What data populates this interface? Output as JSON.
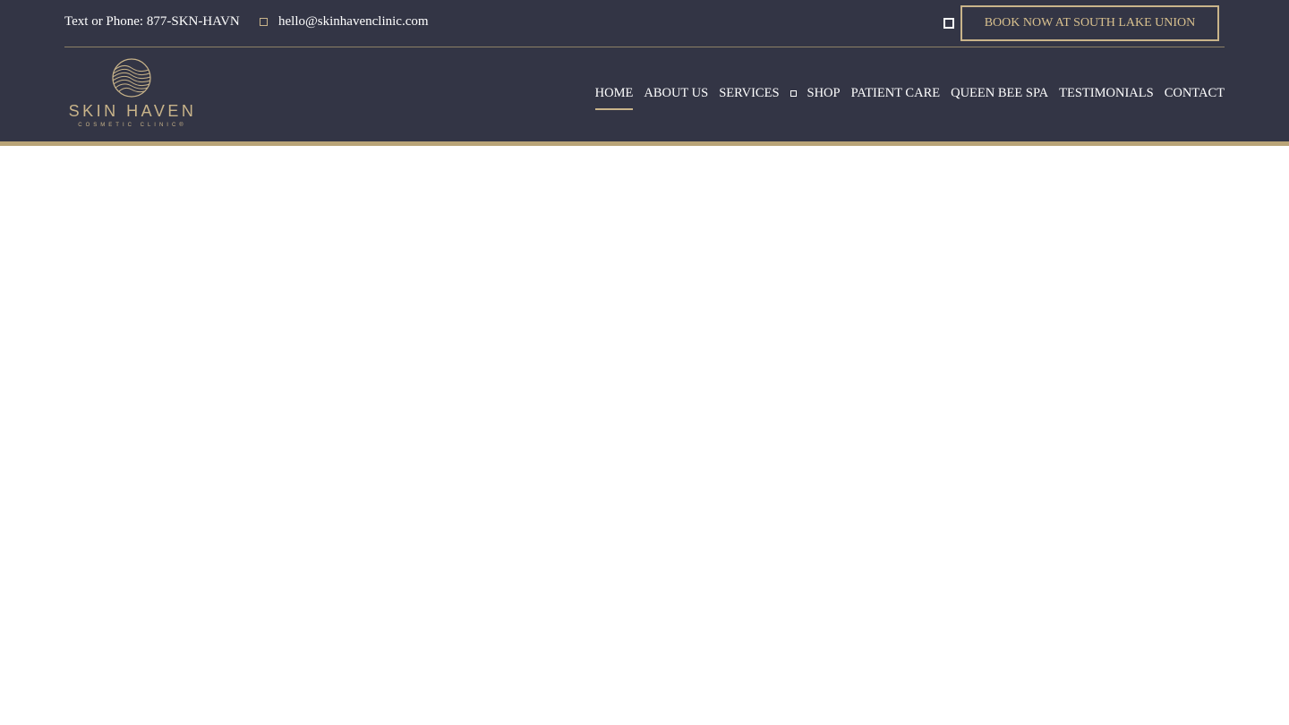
{
  "topbar": {
    "phone": "Text or Phone: 877-SKN-HAVN",
    "email": "hello@skinhavenclinic.com",
    "book_label": "BOOK NOW AT SOUTH LAKE UNION"
  },
  "logo": {
    "name": "SKIN HAVEN",
    "tagline": "COSMETIC CLINIC®"
  },
  "nav": {
    "items": [
      "HOME",
      "ABOUT US",
      "SERVICES",
      "SHOP",
      "PATIENT CARE",
      "QUEEN BEE SPA",
      "TESTIMONIALS",
      "CONTACT"
    ],
    "active": "HOME"
  },
  "colors": {
    "header_bg": "#333545",
    "accent_gold": "#c9b48a",
    "text": "#ffffff"
  },
  "icons": {
    "email": "square-icon",
    "services_dropdown": "square-icon",
    "extra_button": "square-icon"
  }
}
